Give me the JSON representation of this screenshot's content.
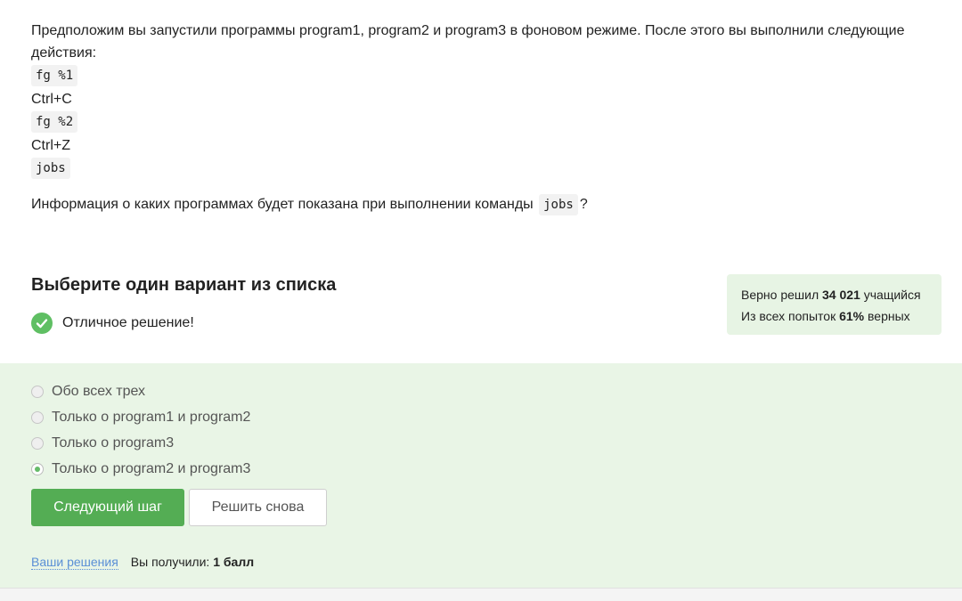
{
  "question": {
    "intro": "Предположим вы запустили программы program1, program2 и program3 в фоновом режиме. После этого вы выполнили следующие действия:",
    "steps": [
      {
        "text": "fg %1",
        "code": true
      },
      {
        "text": "Ctrl+C",
        "code": false
      },
      {
        "text": "fg %2",
        "code": true
      },
      {
        "text": "Ctrl+Z",
        "code": false
      },
      {
        "text": "jobs",
        "code": true
      }
    ],
    "ask_before": "Информация о каких программах будет показана при выполнении команды",
    "ask_code": "jobs",
    "ask_after": "?"
  },
  "task": {
    "heading": "Выберите один вариант из списка",
    "feedback": "Отличное решение!"
  },
  "stats": {
    "line1_before": "Верно решил",
    "line1_value": "34 021",
    "line1_after": "учащийся",
    "line2_before": "Из всех попыток",
    "line2_value": "61%",
    "line2_after": "верных"
  },
  "options": [
    {
      "label": "Обо всех трех",
      "checked": false
    },
    {
      "label": "Только о program1 и program2",
      "checked": false
    },
    {
      "label": "Только о program3",
      "checked": false
    },
    {
      "label": "Только о program2 и program3",
      "checked": true
    }
  ],
  "buttons": {
    "next": "Следующий шаг",
    "retry": "Решить снова"
  },
  "footer": {
    "link": "Ваши решения",
    "received_label": "Вы получили:",
    "score": "1 балл"
  },
  "colors": {
    "accent": "#54ad54",
    "answer_bg": "#e9f5e6",
    "stats_bg": "#e7f4e4",
    "link": "#5a8fd6"
  }
}
